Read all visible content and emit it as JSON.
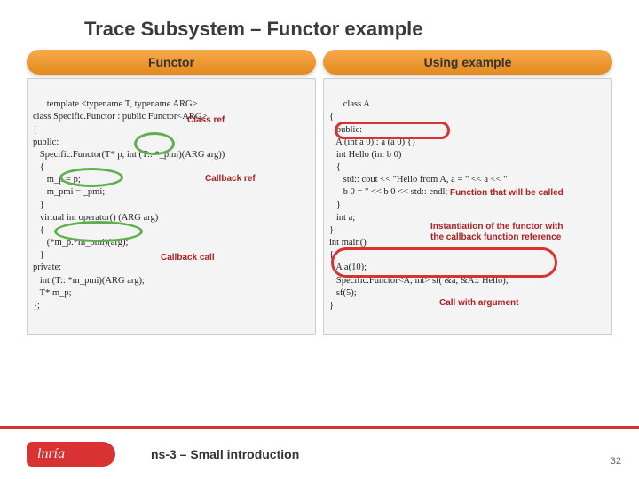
{
  "title": "Trace Subsystem – Functor example",
  "leftHeader": "Functor",
  "rightHeader": "Using example",
  "leftCode": "template <typename T, typename ARG>\nclass Specific.Functor : public Functor<ARG>\n{\npublic:\n   Specific.Functor(T* p, int (T:: *_pmi)(ARG arg))\n   {\n      m_p = p;\n      m_pmi = _pmi;\n   }\n   virtual int operator() (ARG arg)\n   {\n      (*m_p.*m_pmi)(arg);\n   }\nprivate:\n   int (T:: *m_pmi)(ARG arg);\n   T* m_p;\n};",
  "rightCode": "class A\n{\n   public:\n   A (int a 0) : a (a 0) {}\n   int Hello (int b 0)\n   {\n      std:: cout << \"Hello from A, a = \" << a << \"\n      b 0 = \" << b 0 << std:: endl;\n   }\n   int a;\n};\nint main()\n{\n   A a(10);\n   Specific.Functor<A, int> sf( &a, &A:: Hello);\n   sf(5);\n}",
  "annotations": {
    "classRef": "Class ref",
    "callbackRef": "Callback ref",
    "callbackCall": "Callback call",
    "funcCalled": "Function that will be called",
    "instantiation1": "Instantiation of the functor with",
    "instantiation2": "the callback function reference",
    "callArg": "Call with argument"
  },
  "logo": "lnría",
  "footerText": "ns-3 – Small introduction",
  "pageNum": "32"
}
